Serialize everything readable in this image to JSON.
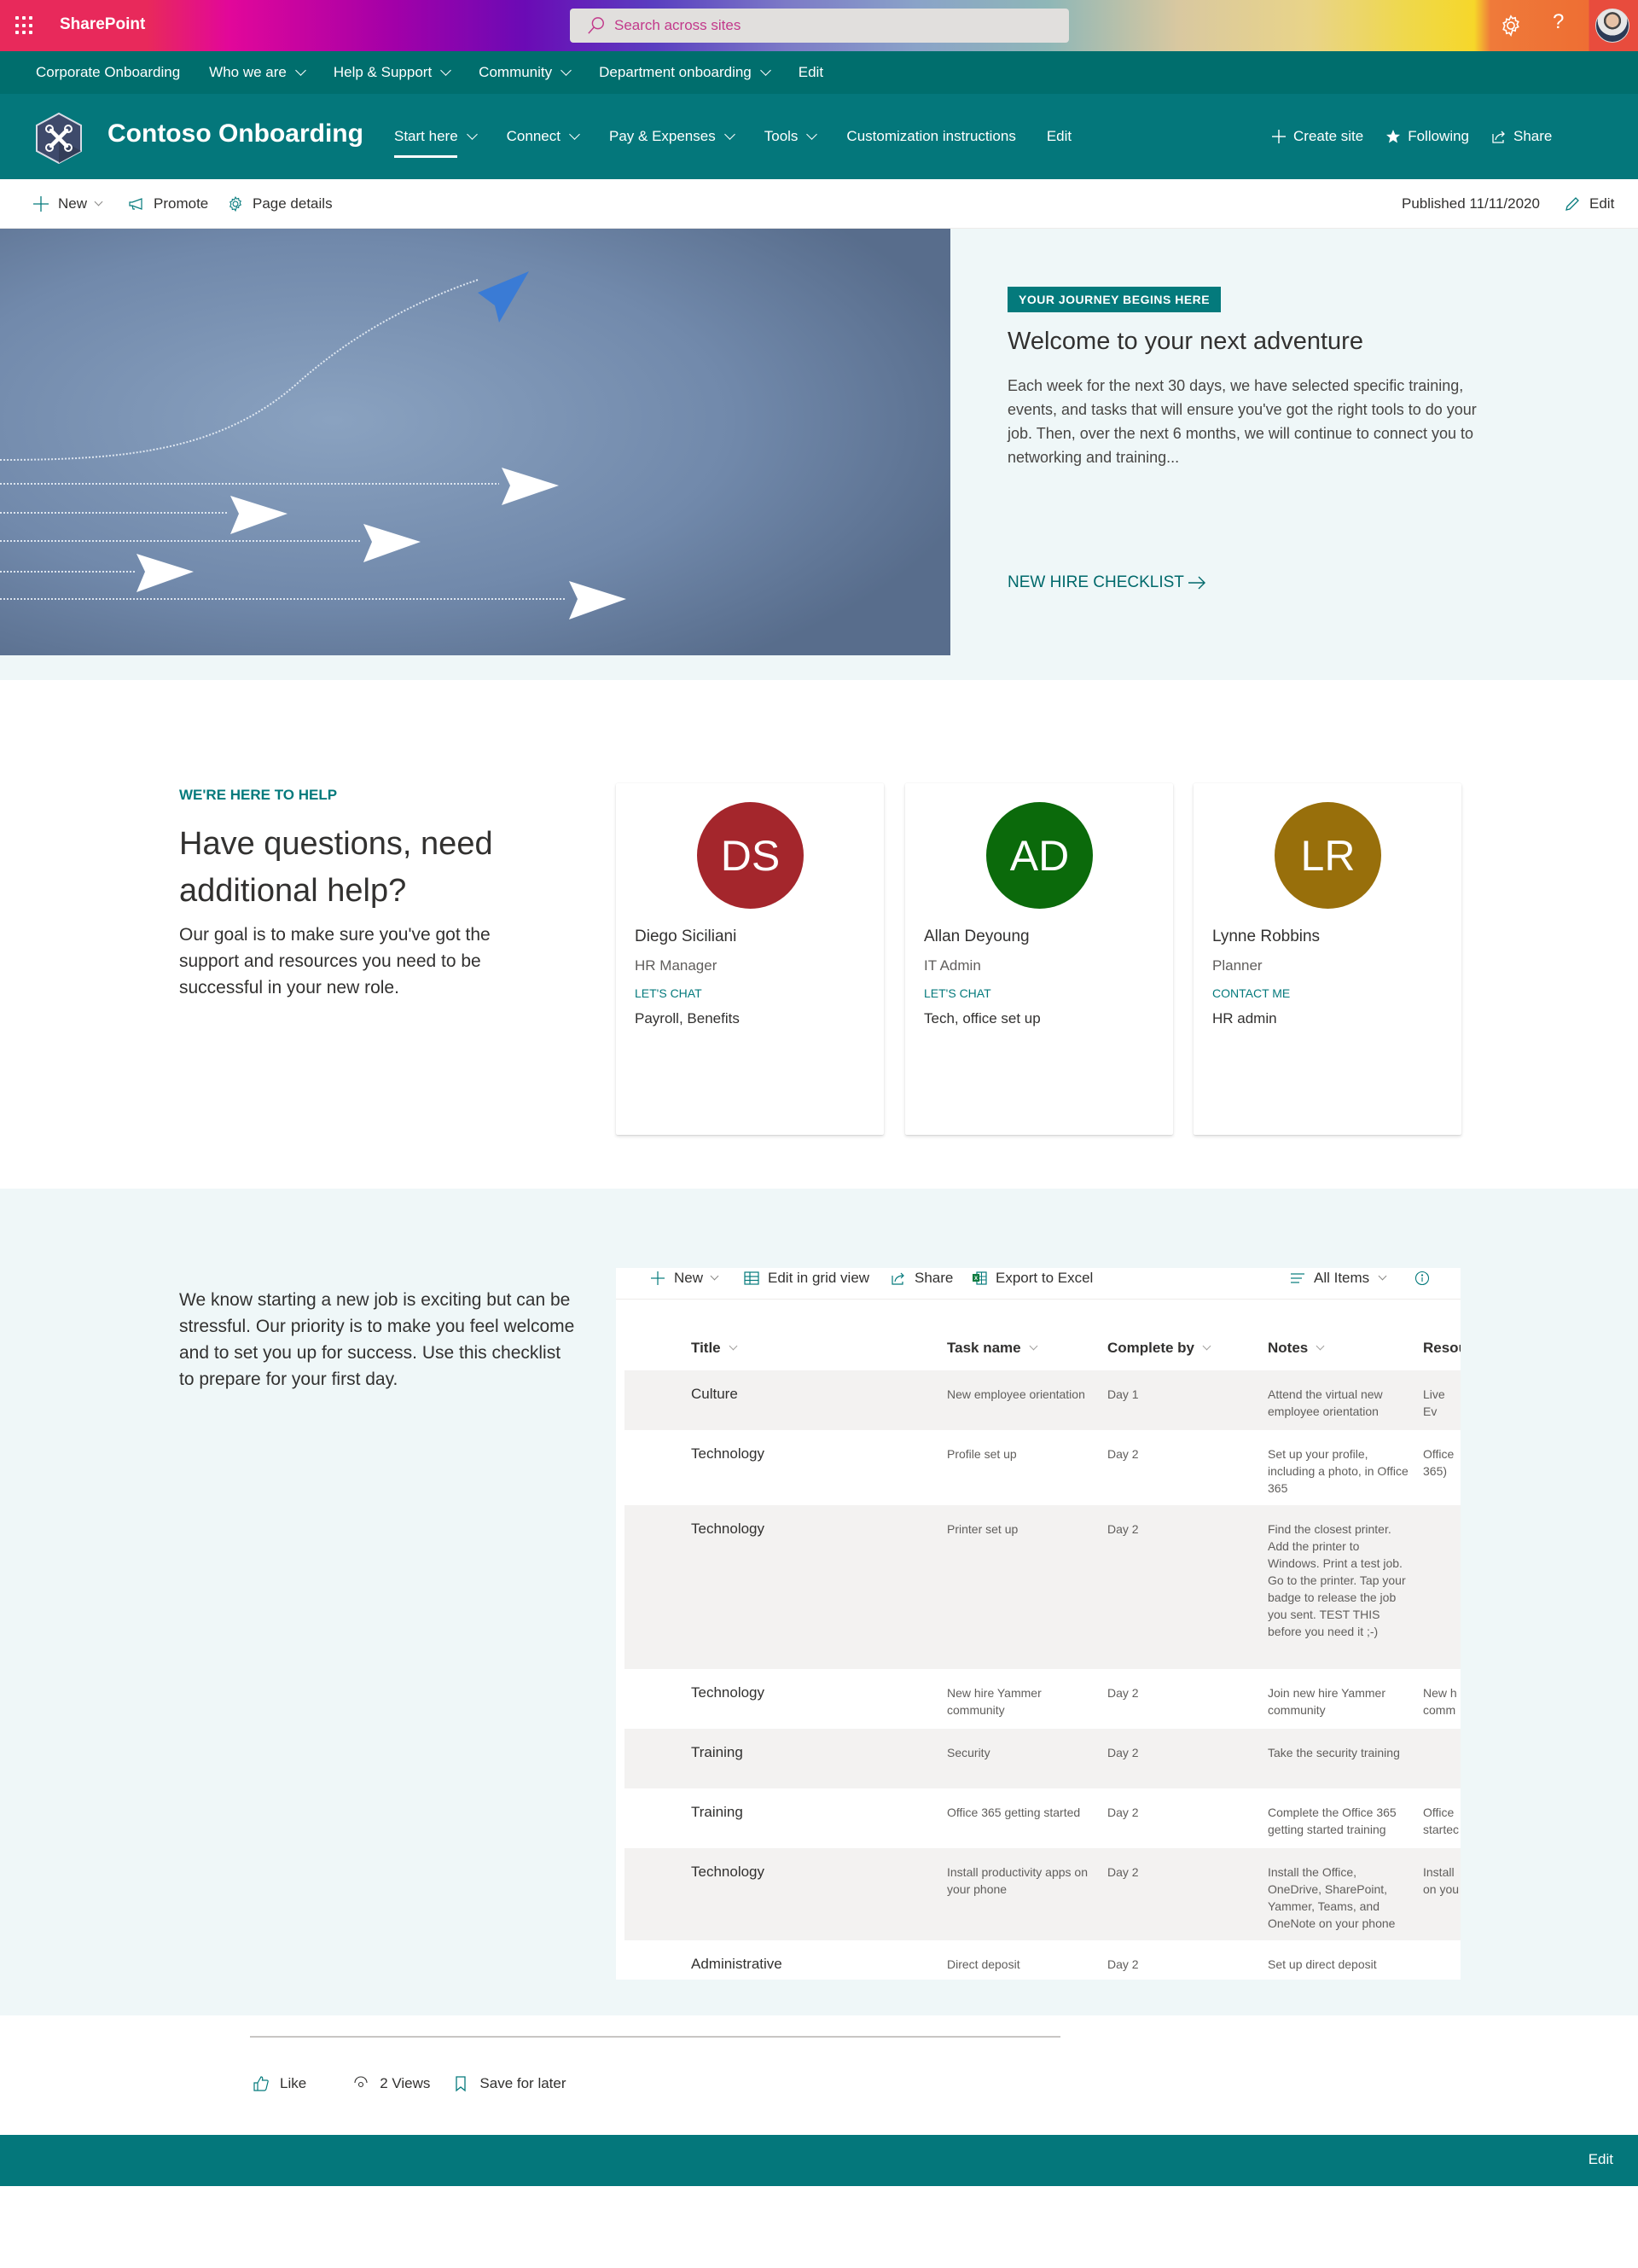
{
  "suite": {
    "app_name": "SharePoint",
    "search_placeholder": "Search across sites",
    "icons": [
      "waffle-icon",
      "search-icon",
      "gear-icon",
      "help-icon",
      "avatar"
    ]
  },
  "hub_nav": {
    "items": [
      {
        "label": "Corporate Onboarding",
        "dropdown": false
      },
      {
        "label": "Who we are",
        "dropdown": true
      },
      {
        "label": "Help & Support",
        "dropdown": true
      },
      {
        "label": "Community",
        "dropdown": true
      },
      {
        "label": "Department onboarding",
        "dropdown": true
      },
      {
        "label": "Edit",
        "dropdown": false
      }
    ]
  },
  "site": {
    "title": "Contoso Onboarding",
    "nav": [
      {
        "label": "Start here",
        "dropdown": true,
        "active": true
      },
      {
        "label": "Connect",
        "dropdown": true
      },
      {
        "label": "Pay & Expenses",
        "dropdown": true
      },
      {
        "label": "Tools",
        "dropdown": true
      },
      {
        "label": "Customization instructions",
        "dropdown": false
      },
      {
        "label": "Edit",
        "dropdown": false
      }
    ],
    "actions": {
      "create_site": "Create site",
      "following": "Following",
      "share": "Share"
    }
  },
  "command_bar": {
    "new": "New",
    "promote": "Promote",
    "page_details": "Page details",
    "published": "Published 11/11/2020",
    "edit": "Edit"
  },
  "hero": {
    "eyebrow": "YOUR JOURNEY BEGINS HERE",
    "title": "Welcome to your next adventure",
    "body": "Each week for the next 30 days, we have selected specific training, events, and tasks that will ensure you've got the right tools to do your job. Then, over the next 6 months, we will continue to connect you to networking and training...",
    "link": "NEW HIRE CHECKLIST",
    "image_alt": "Paper airplanes with one blue plane rising above white planes"
  },
  "help": {
    "eyebrow": "WE'RE HERE TO HELP",
    "title": "Have questions, need additional help?",
    "body": "Our goal is to make sure you've got the support and resources you need to be successful in your new role.",
    "contacts": [
      {
        "initials": "DS",
        "name": "Diego Siciliani",
        "title": "HR Manager",
        "link": "LET'S CHAT",
        "description": "Payroll, Benefits",
        "color": "#a4262c"
      },
      {
        "initials": "AD",
        "name": "Allan Deyoung",
        "title": "IT Admin",
        "link": "LET'S CHAT",
        "description": "Tech, office set up",
        "color": "#0b6a0b"
      },
      {
        "initials": "LR",
        "name": "Lynne Robbins",
        "title": "Planner",
        "link": "CONTACT ME",
        "description": "HR admin",
        "color": "#986f0b"
      }
    ]
  },
  "checklist": {
    "title": "New hire checklist",
    "body": "We know starting a new job is exciting but can be stressful. Our priority is to make you feel welcome and to set you up for success. Use this checklist to prepare for your first day.",
    "toolbar": {
      "new": "New",
      "edit_grid": "Edit in grid view",
      "share": "Share",
      "export": "Export to Excel",
      "view": "All Items"
    },
    "columns": [
      "Title",
      "Task name",
      "Complete by",
      "Notes",
      "Resou"
    ],
    "rows": [
      {
        "title": "Culture",
        "task": "New employee orientation",
        "complete_by": "Day 1",
        "notes": "Attend the virtual new employee orientation",
        "resources": "Live Ev"
      },
      {
        "title": "Technology",
        "task": "Profile set up",
        "complete_by": "Day 2",
        "notes": "Set up your profile, including a photo, in Office 365",
        "resources": "Office 365)"
      },
      {
        "title": "Technology",
        "task": "Printer set up",
        "complete_by": "Day 2",
        "notes": "Find the closest printer. Add the printer to Windows. Print a test job. Go to the printer. Tap your badge to release the job you sent. TEST THIS before you need it ;-)",
        "resources": ""
      },
      {
        "title": "Technology",
        "task": "New hire Yammer community",
        "complete_by": "Day 2",
        "notes": "Join new hire Yammer community",
        "resources": "New h comm"
      },
      {
        "title": "Training",
        "task": "Security",
        "complete_by": "Day 2",
        "notes": "Take the security training",
        "resources": ""
      },
      {
        "title": "Training",
        "task": "Office 365 getting started",
        "complete_by": "Day 2",
        "notes": "Complete the Office 365 getting started training",
        "resources": "Office startec"
      },
      {
        "title": "Technology",
        "task": "Install productivity apps on your phone",
        "complete_by": "Day 2",
        "notes": "Install the Office, OneDrive, SharePoint, Yammer, Teams, and OneNote on your phone",
        "resources": "Install on you"
      },
      {
        "title": "Administrative",
        "task": "Direct deposit",
        "complete_by": "Day 2",
        "notes": "Set up direct deposit",
        "resources": ""
      }
    ]
  },
  "page_actions": {
    "like": "Like",
    "views": "2 Views",
    "save": "Save for later"
  },
  "footer": {
    "edit": "Edit"
  },
  "colors": {
    "theme_teal": "#04777b",
    "hub_teal": "#006e6d",
    "section_bg": "#eff7f8",
    "link": "#047a7c"
  }
}
